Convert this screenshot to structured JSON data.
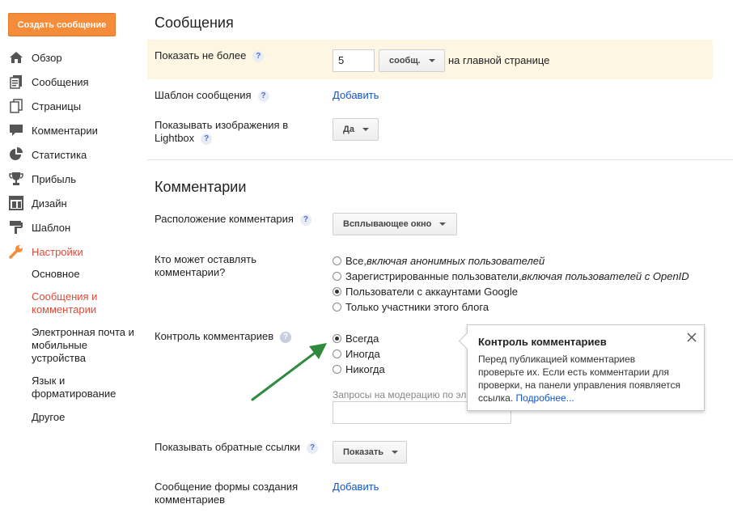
{
  "sidebar": {
    "create_button": "Создать сообщение",
    "items": [
      {
        "label": "Обзор",
        "icon": "home-icon"
      },
      {
        "label": "Сообщения",
        "icon": "posts-icon"
      },
      {
        "label": "Страницы",
        "icon": "pages-icon"
      },
      {
        "label": "Комментарии",
        "icon": "comments-icon"
      },
      {
        "label": "Статистика",
        "icon": "stats-icon"
      },
      {
        "label": "Прибыль",
        "icon": "earnings-icon"
      },
      {
        "label": "Дизайн",
        "icon": "layout-icon"
      },
      {
        "label": "Шаблон",
        "icon": "template-icon"
      },
      {
        "label": "Настройки",
        "icon": "settings-icon",
        "active": true
      }
    ],
    "subitems": [
      {
        "label": "Основное"
      },
      {
        "label": "Сообщения и комментарии",
        "active": true
      },
      {
        "label": "Электронная почта и мобильные устройства"
      },
      {
        "label": "Язык и форматирование"
      },
      {
        "label": "Другое"
      }
    ],
    "accent_color": "#dd4b39",
    "button_color": "#f58c3a"
  },
  "posts_section": {
    "title": "Сообщения",
    "show_max": {
      "label": "Показать не более",
      "value": "5",
      "unit_dropdown": "сообщ.",
      "suffix": "на главной странице"
    },
    "template": {
      "label": "Шаблон сообщения",
      "link": "Добавить"
    },
    "lightbox": {
      "label": "Показывать изображения в Lightbox",
      "dropdown": "Да"
    }
  },
  "comments_section": {
    "title": "Комментарии",
    "location": {
      "label": "Расположение комментария",
      "dropdown": "Всплывающее окно"
    },
    "who_can": {
      "label": "Кто может оставлять комментарии?",
      "options": [
        {
          "text": "Все, ",
          "italic": "включая анонимных пользователей",
          "selected": false
        },
        {
          "text": "Зарегистрированные пользователи, ",
          "italic": "включая пользователей с OpenID",
          "selected": false
        },
        {
          "text": "Пользователи с аккаунтами Google",
          "italic": "",
          "selected": true
        },
        {
          "text": "Только участники этого блога",
          "italic": "",
          "selected": false
        }
      ]
    },
    "moderation": {
      "label": "Контроль комментариев",
      "options": [
        {
          "text": "Всегда",
          "selected": true
        },
        {
          "text": "Иногда",
          "selected": false
        },
        {
          "text": "Никогда",
          "selected": false
        }
      ],
      "requests_label": "Запросы на модерацию по эл",
      "requests_value": ""
    },
    "backlinks": {
      "label": "Показывать обратные ссылки",
      "dropdown": "Показать"
    },
    "form_message": {
      "label": "Сообщение формы создания комментариев",
      "link": "Добавить"
    }
  },
  "tooltip": {
    "title": "Контроль комментариев",
    "body": "Перед публикацией комментариев проверьте их. Если есть комментарии для проверки, на панели управления появляется ссылка.",
    "link": "Подробнее..."
  },
  "arrow_color": "#2e8b3e"
}
